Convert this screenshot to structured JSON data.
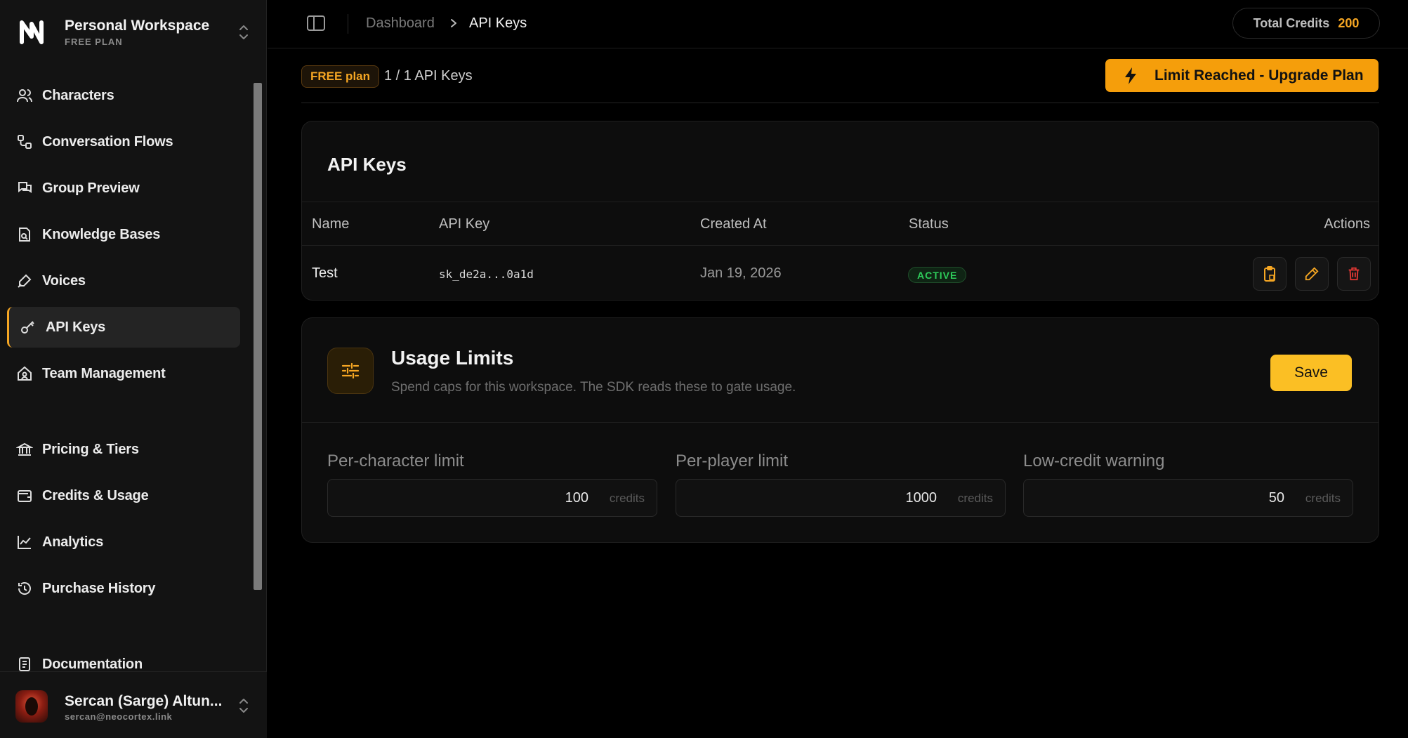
{
  "workspace": {
    "name": "Personal Workspace",
    "plan": "FREE PLAN"
  },
  "nav": {
    "characters": "Characters",
    "conversation_flows": "Conversation Flows",
    "group_preview": "Group Preview",
    "knowledge_bases": "Knowledge Bases",
    "voices": "Voices",
    "api_keys": "API Keys",
    "team_management": "Team Management",
    "pricing": "Pricing & Tiers",
    "credits": "Credits & Usage",
    "analytics": "Analytics",
    "purchase_history": "Purchase History",
    "documentation": "Documentation"
  },
  "user": {
    "name": "Sercan (Sarge) Altun...",
    "email": "sercan@neocortex.link"
  },
  "breadcrumb": {
    "home": "Dashboard",
    "current": "API Keys"
  },
  "credits": {
    "label": "Total Credits",
    "value": "200"
  },
  "plan_bar": {
    "badge": "FREE plan",
    "count": "1 / 1 API Keys",
    "upgrade_label": "Limit Reached - Upgrade Plan"
  },
  "keys_card": {
    "title": "API Keys",
    "columns": {
      "name": "Name",
      "key": "API Key",
      "created": "Created At",
      "status": "Status",
      "actions": "Actions"
    },
    "rows": [
      {
        "name": "Test",
        "key": "sk_de2a...0a1d",
        "created": "Jan 19, 2026",
        "status": "ACTIVE"
      }
    ]
  },
  "usage_card": {
    "title": "Usage Limits",
    "subtitle": "Spend caps for this workspace. The SDK reads these to gate usage.",
    "save_label": "Save",
    "fields": [
      {
        "label": "Per-character limit",
        "value": "100",
        "unit": "credits"
      },
      {
        "label": "Per-player limit",
        "value": "1000",
        "unit": "credits"
      },
      {
        "label": "Low-credit warning",
        "value": "50",
        "unit": "credits"
      }
    ]
  },
  "colors": {
    "accent": "#f59e0b",
    "active_status": "#2ecc5a",
    "danger": "#e53935"
  }
}
